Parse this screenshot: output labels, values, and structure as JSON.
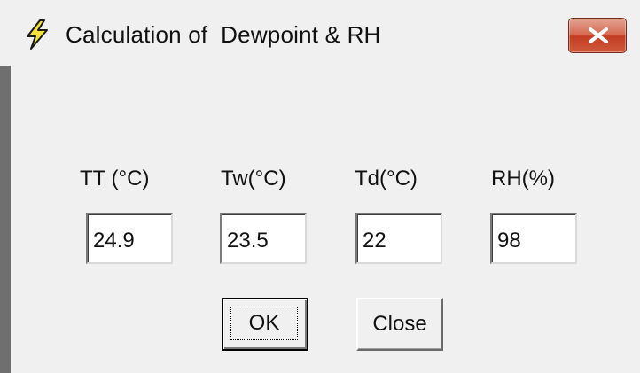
{
  "window": {
    "title": "Calculation of  Dewpoint & RH",
    "icon": "lightning-bolt-icon",
    "close_icon": "close-x-icon"
  },
  "fields": [
    {
      "label": "TT (°C)",
      "value": "24.9"
    },
    {
      "label": "Tw(°C)",
      "value": "23.5"
    },
    {
      "label": "Td(°C)",
      "value": "22"
    },
    {
      "label": "RH(%)",
      "value": "98"
    }
  ],
  "buttons": {
    "ok_label": "OK",
    "close_label": "Close"
  },
  "colors": {
    "window_bg": "#f0f0f0",
    "close_button": "#c94a2e",
    "icon_fill": "#f5e23a"
  }
}
